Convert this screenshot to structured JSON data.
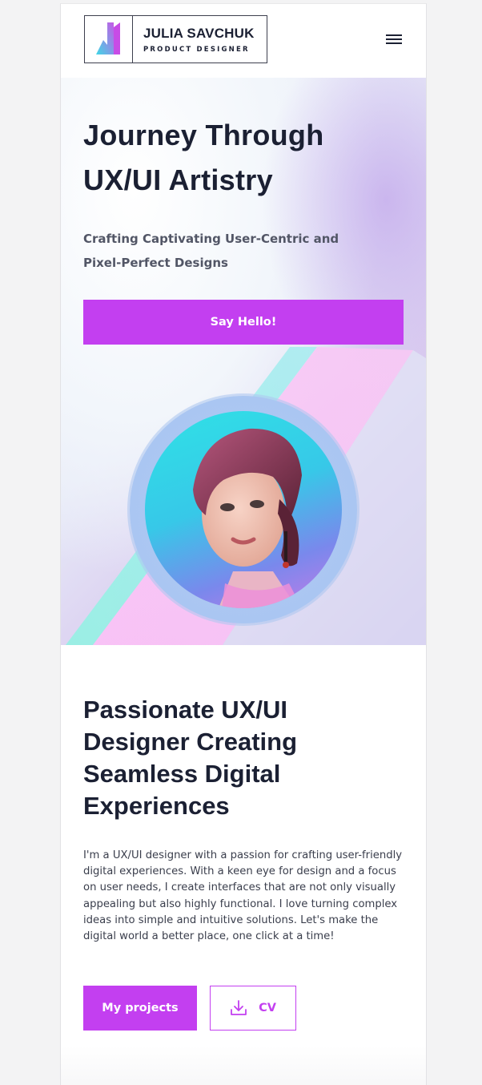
{
  "header": {
    "name": "JULIA SAVCHUK",
    "role": "PRODUCT DESIGNER",
    "menu_icon": "hamburger-icon"
  },
  "hero": {
    "title_line1": "Journey Through",
    "title_line2": "UX/UI Artistry",
    "subtitle_line1": "Crafting Captivating User-Centric and",
    "subtitle_line2": "Pixel-Perfect Designs",
    "cta_label": "Say Hello!"
  },
  "about": {
    "title": "Passionate UX/UI Designer Creating Seamless Digital Experiences",
    "body": "I'm a UX/UI designer with a passion for crafting user-friendly digital experiences. With a keen eye for design and a focus on user needs, I create interfaces that are not only visually appealing but also highly functional. I love turning complex ideas into simple and intuitive solutions. Let's make the digital world a better place, one click at a time!",
    "projects_label": "My projects",
    "cv_label": "CV",
    "cv_icon": "download-icon"
  },
  "colors": {
    "accent": "#c33ff0",
    "text_dark": "#1b2033",
    "stripe_cyan": "#8ff0e4",
    "stripe_pink": "#fbc3f7"
  }
}
